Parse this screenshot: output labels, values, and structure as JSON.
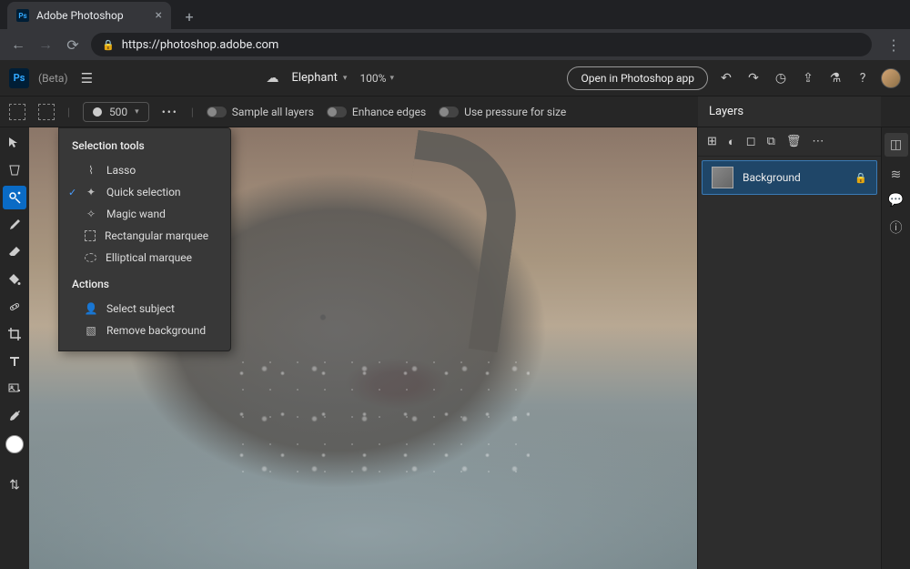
{
  "browser": {
    "tab_title": "Adobe Photoshop",
    "url": "https://photoshop.adobe.com"
  },
  "header": {
    "beta": "(Beta)",
    "doc_name": "Elephant",
    "zoom": "100%",
    "open_app": "Open in Photoshop app"
  },
  "options": {
    "brush_size": "500",
    "sample_all": "Sample all layers",
    "enhance_edges": "Enhance edges",
    "pressure_size": "Use pressure for size"
  },
  "flyout": {
    "section1": "Selection tools",
    "items": [
      {
        "label": "Lasso",
        "icon": "lasso"
      },
      {
        "label": "Quick selection",
        "icon": "quick",
        "checked": true
      },
      {
        "label": "Magic wand",
        "icon": "wand"
      },
      {
        "label": "Rectangular marquee",
        "icon": "rect"
      },
      {
        "label": "Elliptical marquee",
        "icon": "ellipse"
      }
    ],
    "section2": "Actions",
    "actions": [
      {
        "label": "Select subject",
        "icon": "subject"
      },
      {
        "label": "Remove background",
        "icon": "removebg"
      }
    ]
  },
  "layers_panel": {
    "title": "Layers",
    "layer_name": "Background"
  }
}
